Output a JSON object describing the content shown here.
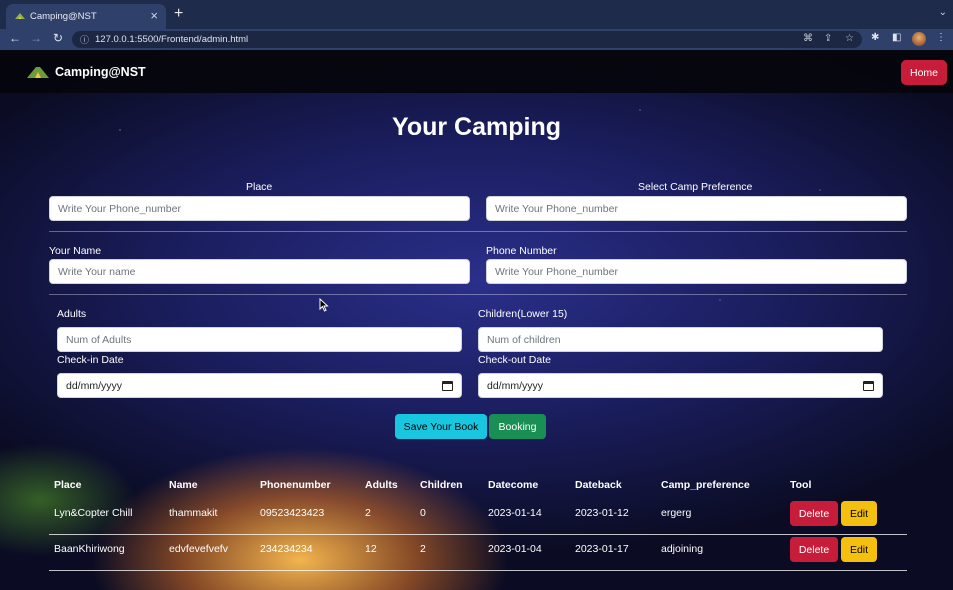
{
  "browser": {
    "tab_title": "Camping@NST",
    "url": "127.0.0.1:5500/Frontend/admin.html"
  },
  "navbar": {
    "brand": "Camping@NST",
    "home_label": "Home"
  },
  "heading": "Your Camping",
  "form": {
    "place": {
      "label": "Place",
      "placeholder": "Write Your Phone_number"
    },
    "camp_preference": {
      "label": "Select Camp Preference",
      "placeholder": "Write Your Phone_number"
    },
    "name": {
      "label": "Your Name",
      "placeholder": "Write Your name"
    },
    "phone": {
      "label": "Phone Number",
      "placeholder": "Write Your Phone_number"
    },
    "adults": {
      "label": "Adults",
      "placeholder": "Num of Adults"
    },
    "children": {
      "label": "Children(Lower 15)",
      "placeholder": "Num of children"
    },
    "checkin": {
      "label": "Check-in Date",
      "value": "dd/mm/yyyy"
    },
    "checkout": {
      "label": "Check-out Date",
      "value": "dd/mm/yyyy"
    },
    "save_label": "Save Your Book",
    "booking_label": "Booking"
  },
  "table": {
    "headers": [
      "Place",
      "Name",
      "Phonenumber",
      "Adults",
      "Children",
      "Datecome",
      "Dateback",
      "Camp_preference",
      "Tool"
    ],
    "rows": [
      {
        "place": "Lyn&Copter Chill",
        "name": "thammakit",
        "phone": "09523423423",
        "adults": "2",
        "children": "0",
        "datecome": "2023-01-14",
        "dateback": "2023-01-12",
        "camp_preference": "ergerg",
        "delete": "Delete",
        "edit": "Edit"
      },
      {
        "place": "BaanKhiriwong",
        "name": "edvfevefvefv",
        "phone": "234234234",
        "adults": "12",
        "children": "2",
        "datecome": "2023-01-04",
        "dateback": "2023-01-17",
        "camp_preference": "adjoining",
        "delete": "Delete",
        "edit": "Edit"
      }
    ]
  },
  "colors": {
    "danger": "#c81d3a",
    "info": "#18c6e0",
    "success": "#1a8f55",
    "warning": "#f5bf0f"
  }
}
